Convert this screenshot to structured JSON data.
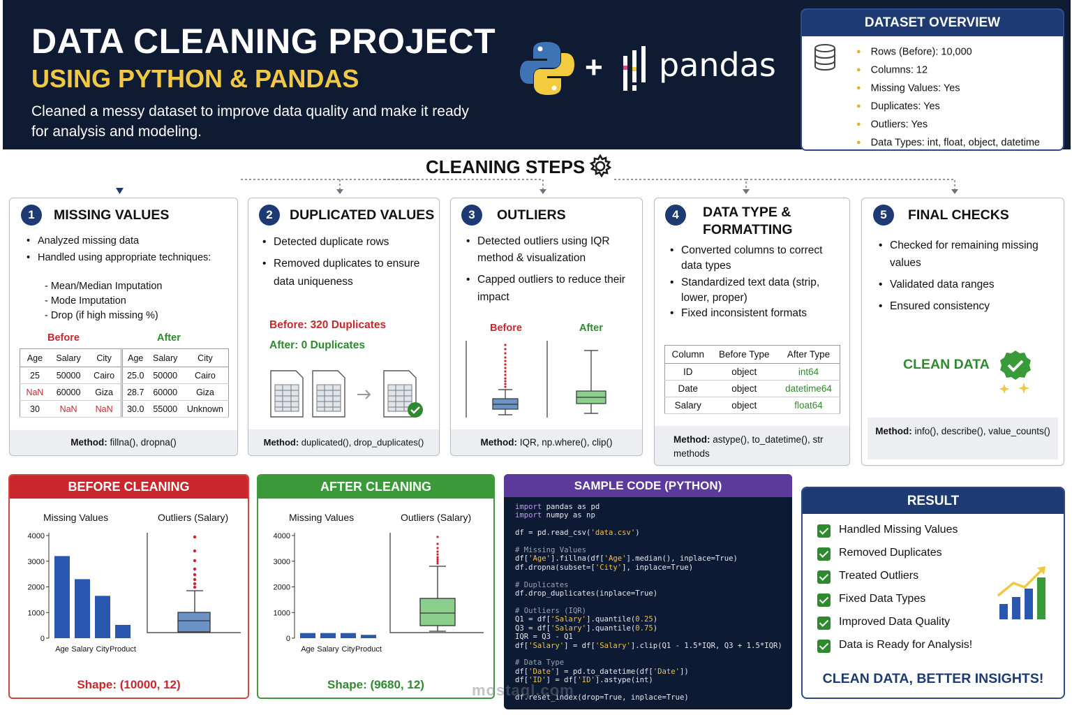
{
  "header": {
    "title": "DATA CLEANING PROJECT",
    "subtitle_highlight": "USING PYTHON & PANDAS",
    "description": "Cleaned a messy dataset to improve data quality and make it ready for analysis and modeling.",
    "plus": "+",
    "pandas_label": "pandas",
    "python_logo": "python-logo",
    "pandas_logo": "pandas-logo"
  },
  "overview": {
    "title": "DATASET OVERVIEW",
    "icon": "database-icon",
    "items": [
      "Rows (Before): 10,000",
      "Columns: 12",
      "Missing Values: Yes",
      "Duplicates: Yes",
      "Outliers: Yes",
      "Data Types: int, float, object, datetime"
    ]
  },
  "steps_title": "CLEANING STEPS",
  "steps": {
    "s1": {
      "num": "1",
      "title": "MISSING VALUES",
      "bullets": [
        "Analyzed missing data",
        "Handled using appropriate techniques:"
      ],
      "subitems": [
        "- Mean/Median Imputation",
        "- Mode Imputation",
        "- Drop (if high missing %)"
      ],
      "before_label": "Before",
      "after_label": "After",
      "before_table": {
        "headers": [
          "Age",
          "Salary",
          "City"
        ],
        "rows": [
          [
            "25",
            "50000",
            "Cairo"
          ],
          [
            "NaN",
            "60000",
            "Giza"
          ],
          [
            "30",
            "NaN",
            "NaN"
          ]
        ]
      },
      "after_table": {
        "headers": [
          "Age",
          "Salary",
          "City"
        ],
        "rows": [
          [
            "25.0",
            "50000",
            "Cairo"
          ],
          [
            "28.7",
            "60000",
            "Giza"
          ],
          [
            "30.0",
            "55000",
            "Unknown"
          ]
        ]
      },
      "method_label": "Method:",
      "method": "fillna(), dropna()"
    },
    "s2": {
      "num": "2",
      "title": "DUPLICATED VALUES",
      "bullets": [
        "Detected duplicate rows",
        "Removed duplicates to ensure data uniqueness"
      ],
      "before_text": "Before: 320 Duplicates",
      "after_text": "After: 0 Duplicates",
      "method_label": "Method:",
      "method": "duplicated(), drop_duplicates()"
    },
    "s3": {
      "num": "3",
      "title": "OUTLIERS",
      "bullets": [
        "Detected outliers using IQR method & visualization",
        "Capped outliers to reduce their impact"
      ],
      "before_label": "Before",
      "after_label": "After",
      "method_label": "Method:",
      "method": "IQR, np.where(), clip()"
    },
    "s4": {
      "num": "4",
      "title": "DATA TYPE & FORMATTING",
      "bullets": [
        "Converted columns to correct data types",
        "Standardized text data (strip, lower, proper)",
        "Fixed inconsistent formats"
      ],
      "table": {
        "headers": [
          "Column",
          "Before Type",
          "After Type"
        ],
        "rows": [
          [
            "ID",
            "object",
            "int64"
          ],
          [
            "Date",
            "object",
            "datetime64"
          ],
          [
            "Salary",
            "object",
            "float64"
          ]
        ]
      },
      "method_label": "Method:",
      "method": "astype(), to_datetime(), str methods"
    },
    "s5": {
      "num": "5",
      "title": "FINAL CHECKS",
      "bullets": [
        "Checked for remaining missing values",
        "Validated data ranges",
        "Ensured consistency"
      ],
      "clean_label": "CLEAN DATA",
      "method_label": "Method:",
      "method": "info(), describe(), value_counts()"
    }
  },
  "before_panel": {
    "title": "BEFORE CLEANING",
    "bar_title": "Missing Values",
    "box_title": "Outliers (Salary)",
    "shape": "Shape: (10000, 12)"
  },
  "after_panel": {
    "title": "AFTER CLEANING",
    "bar_title": "Missing Values",
    "box_title": "Outliers (Salary)",
    "shape": "Shape: (9680, 12)"
  },
  "chart_data": [
    {
      "type": "bar",
      "title": "Missing Values",
      "categories": [
        "Age",
        "Salary",
        "City",
        "Product"
      ],
      "values": [
        3200,
        2300,
        1650,
        520
      ],
      "ylim": [
        0,
        4000
      ],
      "yticks": [
        "4000",
        "3000",
        "2000",
        "1000",
        "0"
      ],
      "color": "#2a58b0"
    },
    {
      "type": "bar",
      "title": "Missing Values",
      "categories": [
        "Age",
        "Salary",
        "City",
        "Product"
      ],
      "values": [
        200,
        200,
        200,
        130
      ],
      "ylim": [
        0,
        4000
      ],
      "yticks": [
        "4000",
        "3000",
        "2000",
        "1000",
        "0"
      ],
      "color": "#2a58b0"
    }
  ],
  "code": {
    "title": "SAMPLE CODE (PYTHON)"
  },
  "result": {
    "title": "RESULT",
    "items": [
      "Handled Missing Values",
      "Removed Duplicates",
      "Treated Outliers",
      "Fixed Data Types",
      "Improved Data Quality",
      "Data is Ready for Analysis!"
    ],
    "footer": "CLEAN DATA, BETTER INSIGHTS!"
  },
  "watermark": "mostaql.com",
  "colors": {
    "navy": "#0f1b33",
    "gold": "#f0c845",
    "red": "#c9272d",
    "green": "#2f8a2f",
    "purple": "#5b3a9b"
  }
}
